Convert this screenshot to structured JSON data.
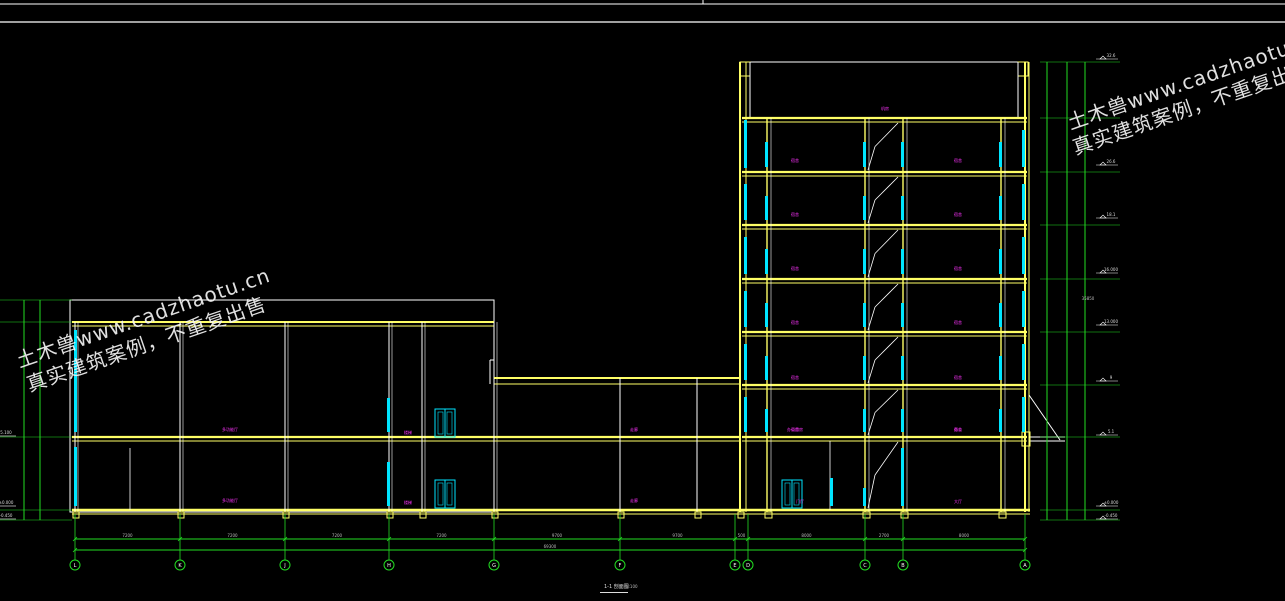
{
  "drawing": {
    "title": "1-1 剖面图",
    "scale": "1:100",
    "colors": {
      "frame": "#ffffff",
      "structure": "#ffff66",
      "glass": "#00e5ff",
      "dimension": "#22dd22",
      "label": "#ff33ff",
      "background": "#000000"
    }
  },
  "watermarks": {
    "left_line1": "土木兽www.cadzhaotu.cn",
    "left_line2": "真实建筑案例，不重复出售",
    "right_line1": "土木兽www.cadzhaotu.cn",
    "right_line2": "真实建筑案例，不重复出售"
  },
  "axes": [
    "L",
    "K",
    "J",
    "H",
    "G",
    "F",
    "E",
    "D",
    "C",
    "B",
    "A"
  ],
  "bay_dims": [
    "7200",
    "7200",
    "7200",
    "7200",
    "9700",
    "9700",
    "500",
    "8000",
    "2700",
    "8000"
  ],
  "total_dim": "69300",
  "right_levels": [
    "32.6",
    "26.6",
    "18.1",
    "16.000",
    "13.000",
    "9",
    "5.1",
    "±0.000",
    "-0.450"
  ],
  "left_levels": [
    "5.100",
    "±0.000",
    "-0.450"
  ],
  "room_labels_left": [
    "多功能厅",
    "多功能厅",
    "楼梯",
    "楼梯"
  ],
  "room_labels_mid": [
    "走廊",
    "走廊"
  ],
  "room_labels_tower": [
    "机房",
    "宿舍",
    "宿舍",
    "宿舍",
    "宿舍",
    "宿舍",
    "宿舍",
    "宿舍",
    "宿舍",
    "宿舍",
    "宿舍",
    "宿舍",
    "宿舍",
    "办公用房",
    "办公",
    "门厅",
    "大厅"
  ]
}
